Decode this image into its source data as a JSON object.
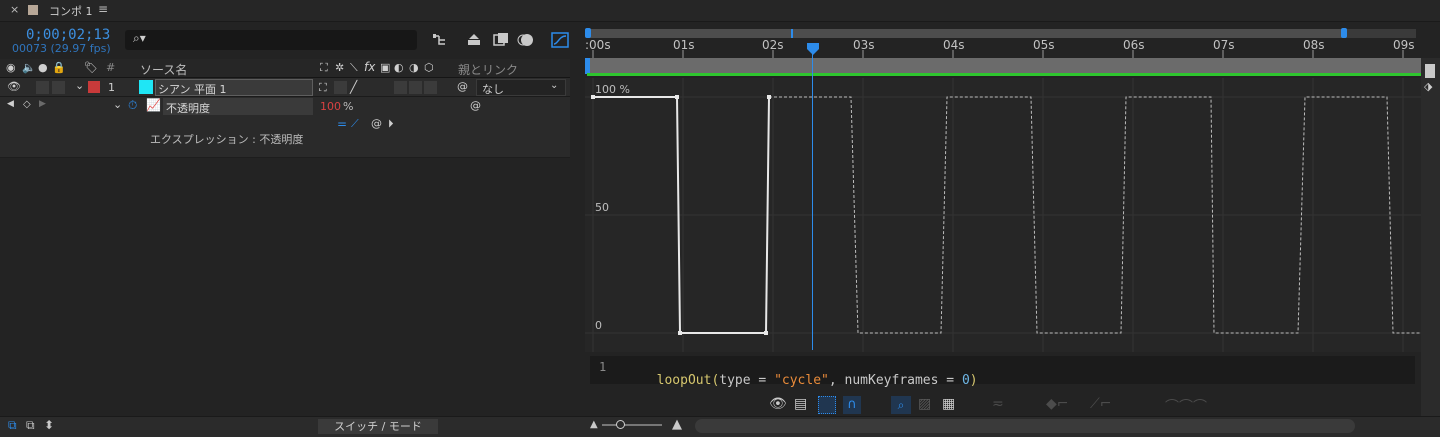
{
  "tab": {
    "close": "×",
    "title": "コンポ 1",
    "menu": "≡",
    "swatch_color": "#b7a797"
  },
  "timecode": {
    "current": "0;00;02;13",
    "frames": "00073 (29.97 fps)"
  },
  "search": {
    "placeholder": "",
    "icon": "search-icon"
  },
  "columns": {
    "hash": "#",
    "source_name": "ソース名",
    "parent_link": "親とリンク",
    "switch_icons": "fx"
  },
  "layer": {
    "index": "1",
    "name": "シアン 平面 1",
    "label_color": "#c83a3a",
    "swatch_color": "#1fe6f5",
    "parent": "なし"
  },
  "property": {
    "name": "不透明度",
    "value": "100",
    "unit": "%",
    "value_color": "#d74141"
  },
  "expression": {
    "label": "エクスプレッション : 不透明度"
  },
  "ruler": {
    "labels": [
      ":00s",
      "01s",
      "02s",
      "03s",
      "04s",
      "05s",
      "06s",
      "07s",
      "08s",
      "09s"
    ],
    "accent": "#2d8ceb"
  },
  "graph": {
    "y_labels": [
      "100 %",
      "50",
      "0"
    ]
  },
  "expr_editor": {
    "line_number": "1",
    "code_fn": "loopOut(",
    "code_arg1": "type = ",
    "code_str": "\"cycle\"",
    "code_mid": ", numKeyframes = ",
    "code_num": "0",
    "code_end": ")"
  },
  "bottom": {
    "switch_mode": "スイッチ / モード"
  },
  "colors": {
    "timecode": "#3c8fe0",
    "green_bar": "#2ec52e",
    "playhead": "#2d8ceb"
  }
}
